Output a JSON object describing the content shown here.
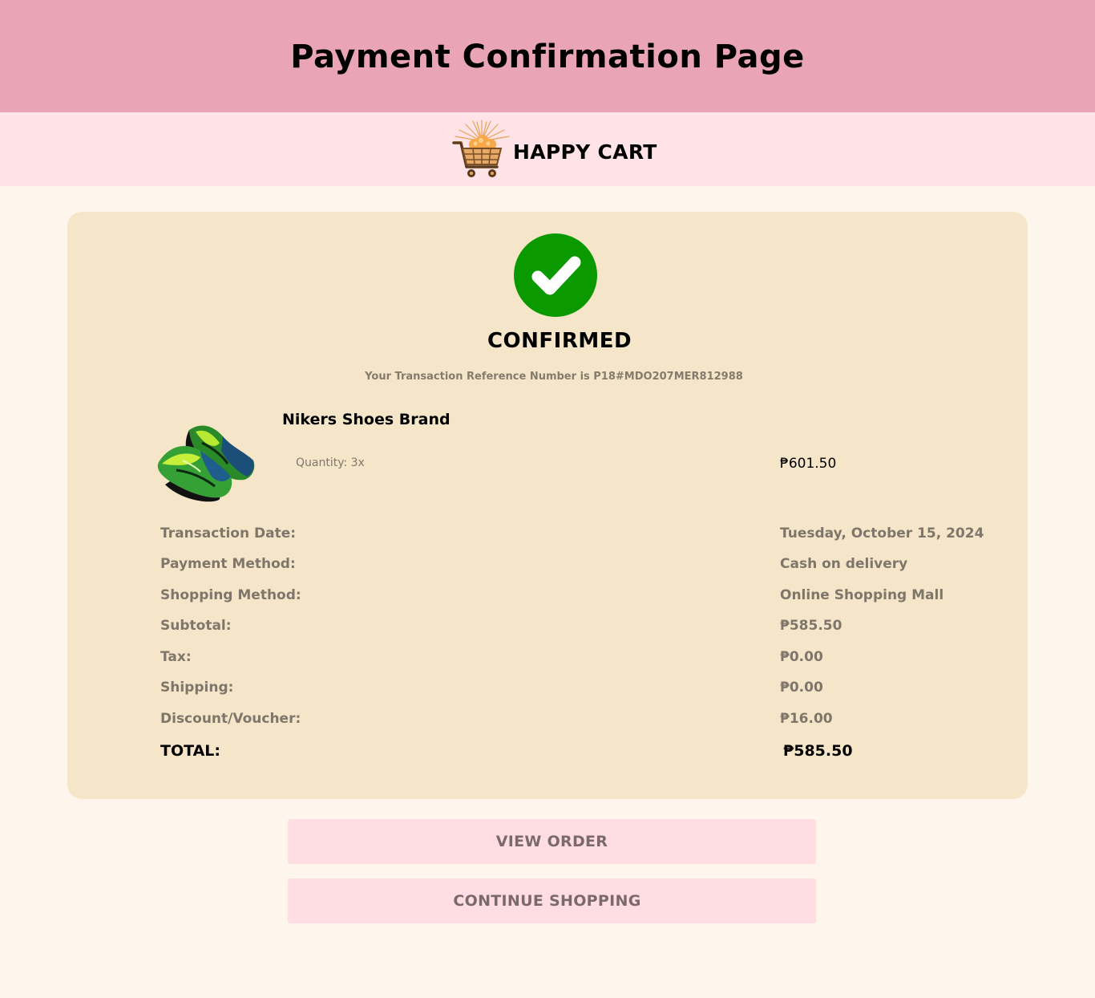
{
  "header": {
    "title": "Payment Confirmation Page"
  },
  "brand": {
    "name": "HAPPY CART",
    "logo_icon": "shopping-cart-fireworks-icon"
  },
  "confirmation": {
    "status_icon": "check-circle-icon",
    "status_color": "#0a9a00",
    "status": "CONFIRMED",
    "reference_text": "Your Transaction Reference Number is P18#MDO207MER812988"
  },
  "product": {
    "name": "Nikers Shoes Brand",
    "quantity": "Quantity: 3x",
    "price": "₱601.50",
    "image_icon": "sneakers-image"
  },
  "summary": {
    "rows": [
      {
        "label": "Transaction Date:",
        "value": "Tuesday, October 15, 2024"
      },
      {
        "label": "Payment Method:",
        "value": "Cash on delivery"
      },
      {
        "label": "Shopping Method:",
        "value": "Online Shopping Mall"
      },
      {
        "label": "Subtotal:",
        "value": "₱585.50"
      },
      {
        "label": "Tax:",
        "value": "₱0.00"
      },
      {
        "label": "Shipping:",
        "value": "₱0.00"
      },
      {
        "label": "Discount/Voucher:",
        "value": "₱16.00"
      }
    ],
    "total_label": "TOTAL:",
    "total_value": "₱585.50"
  },
  "actions": {
    "view_order": "VIEW ORDER",
    "continue_shopping": "CONTINUE SHOPPING"
  },
  "colors": {
    "header_bg": "#e9a5b6",
    "brand_bar_bg": "#ffe3e6",
    "page_bg": "#fef6ec",
    "card_bg": "#f6e6c9",
    "button_bg": "#ffdde3",
    "muted_text": "#7f766b"
  }
}
